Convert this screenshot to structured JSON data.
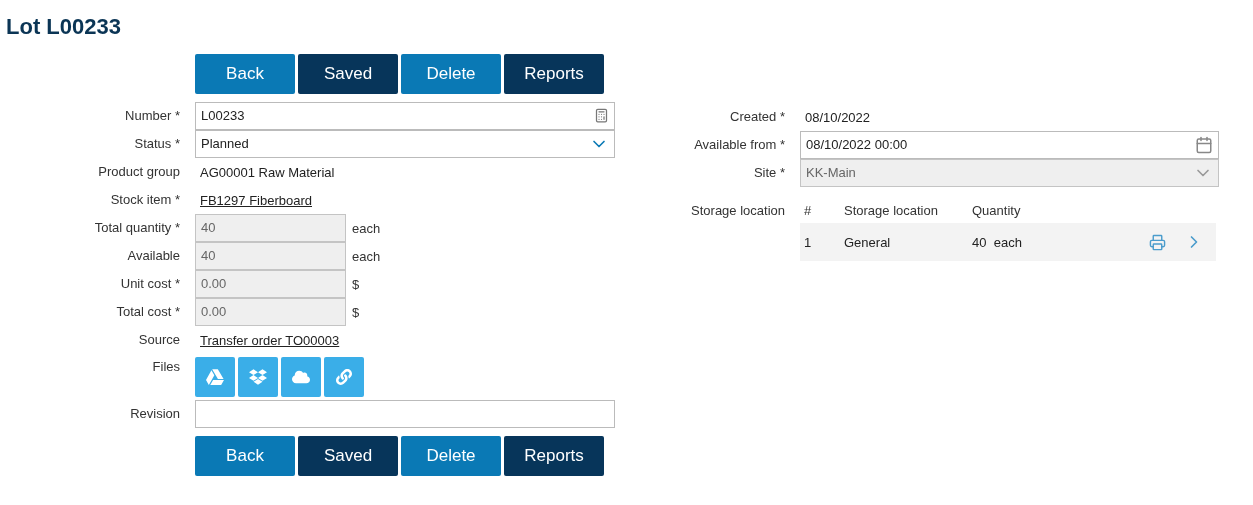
{
  "title": "Lot L00233",
  "toolbar_top": [
    {
      "label": "Back",
      "kind": "light"
    },
    {
      "label": "Saved",
      "kind": "dark"
    },
    {
      "label": "Delete",
      "kind": "light"
    },
    {
      "label": "Reports",
      "kind": "dark"
    }
  ],
  "left_fields": [
    {
      "label": "Number *",
      "kind": "input",
      "value": "L00233"
    },
    {
      "label": "Status *",
      "kind": "select",
      "value": "Planned",
      "disabled": false
    },
    {
      "label": "Product group",
      "kind": "text",
      "value": "AG00001 Raw Material"
    },
    {
      "label": "Stock item *",
      "kind": "link",
      "value": "FB1297 Fiberboard"
    },
    {
      "label": "Total quantity *",
      "kind": "readonly",
      "value": "40",
      "unit": "each"
    },
    {
      "label": "Available",
      "kind": "readonly",
      "value": "40",
      "unit": "each"
    },
    {
      "label": "Unit cost *",
      "kind": "readonly",
      "value": "0.00",
      "unit": "$"
    },
    {
      "label": "Total cost *",
      "kind": "readonly",
      "value": "0.00",
      "unit": "$"
    },
    {
      "label": "Source",
      "kind": "link",
      "value": "Transfer order TO00003"
    },
    {
      "label": "Files",
      "kind": "files"
    },
    {
      "label": "Revision",
      "kind": "input"
    }
  ],
  "toolbar_bottom": [
    {
      "label": "Back",
      "kind": "light"
    },
    {
      "label": "Saved",
      "kind": "dark"
    },
    {
      "label": "Delete",
      "kind": "light"
    },
    {
      "label": "Reports",
      "kind": "dark"
    }
  ],
  "right_fields": [
    {
      "label": "Created *",
      "kind": "text",
      "value": "08/10/2022"
    },
    {
      "label": "Available from *",
      "kind": "date",
      "value": "08/10/2022 00:00"
    },
    {
      "label": "Site *",
      "kind": "select",
      "value": "KK-Main",
      "disabled": true
    }
  ],
  "storage": {
    "label": "Storage location",
    "columns": [
      "#",
      "Storage location",
      "Quantity"
    ],
    "rows": [
      {
        "number": "1",
        "location": "General",
        "quantity": "40",
        "unit": "each"
      }
    ]
  }
}
